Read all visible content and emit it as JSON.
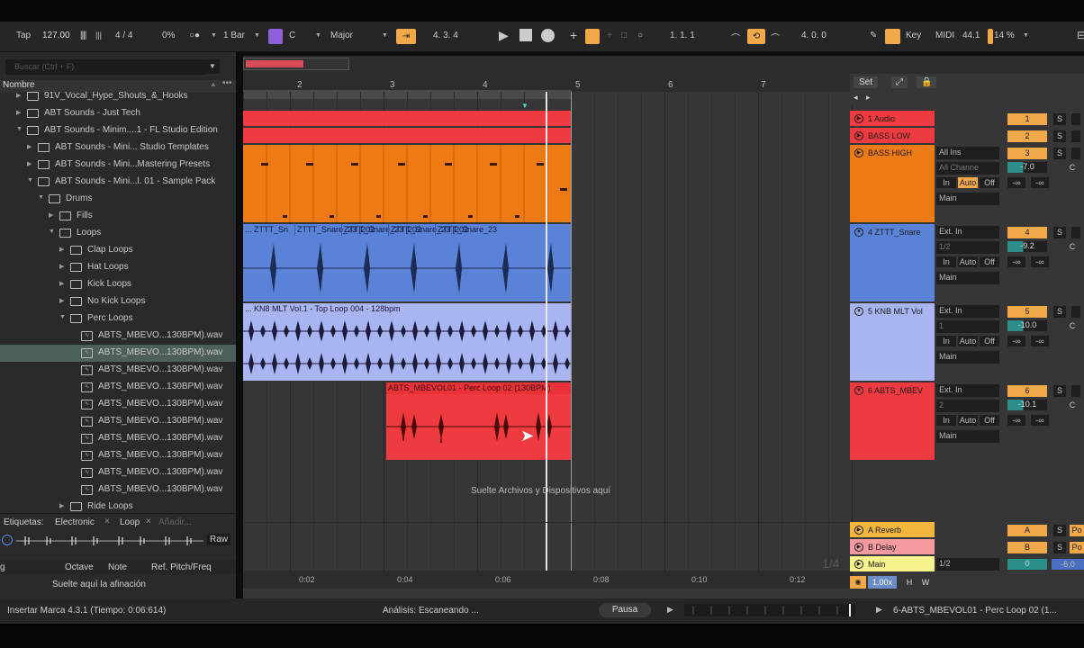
{
  "control_bar": {
    "tap": "Tap",
    "tempo": "127.00",
    "signature": "4 / 4",
    "swing": "0%",
    "quantize": "1 Bar",
    "key": "C",
    "scale": "Major",
    "position": "4.  3.  4",
    "loop_start": "1.  1.  1",
    "loop_length": "4.  0.  0",
    "key_btn": "Key",
    "midi_btn": "MIDI",
    "sample_rate": "44.1",
    "cpu": "14 %"
  },
  "browser": {
    "search_placeholder": "Buscar (Ctrl + F)",
    "column_header": "Nombre",
    "items": [
      {
        "label": "91V_Vocal_Hype_Shouts_&_Hooks",
        "type": "folder"
      },
      {
        "label": "ABT Sounds - Just Tech",
        "type": "folder"
      },
      {
        "label": "ABT Sounds - Minim....1 - FL Studio Edition",
        "type": "folder"
      },
      {
        "label": "ABT Sounds - Mini... Studio Templates",
        "type": "folder"
      },
      {
        "label": "ABT Sounds - Mini...Mastering Presets",
        "type": "folder"
      },
      {
        "label": "ABT Sounds - Mini...l. 01 - Sample Pack",
        "type": "folder"
      },
      {
        "label": "Drums",
        "type": "folder"
      },
      {
        "label": "Fills",
        "type": "folder"
      },
      {
        "label": "Loops",
        "type": "folder"
      },
      {
        "label": "Clap Loops",
        "type": "folder"
      },
      {
        "label": "Hat Loops",
        "type": "folder"
      },
      {
        "label": "Kick Loops",
        "type": "folder"
      },
      {
        "label": "No Kick Loops",
        "type": "folder"
      },
      {
        "label": "Perc Loops",
        "type": "folder"
      },
      {
        "label": "ABTS_MBEVO...130BPM).wav",
        "type": "file"
      },
      {
        "label": "ABTS_MBEVO...130BPM).wav",
        "type": "file"
      },
      {
        "label": "ABTS_MBEVO...130BPM).wav",
        "type": "file"
      },
      {
        "label": "ABTS_MBEVO...130BPM).wav",
        "type": "file"
      },
      {
        "label": "ABTS_MBEVO...130BPM).wav",
        "type": "file"
      },
      {
        "label": "ABTS_MBEVO...130BPM).wav",
        "type": "file"
      },
      {
        "label": "ABTS_MBEVO...130BPM).wav",
        "type": "file"
      },
      {
        "label": "ABTS_MBEVO...130BPM).wav",
        "type": "file"
      },
      {
        "label": "ABTS_MBEVO...130BPM).wav",
        "type": "file"
      },
      {
        "label": "ABTS_MBEVO...130BPM).wav",
        "type": "file"
      },
      {
        "label": "Ride Loops",
        "type": "folder"
      }
    ],
    "tags_label": "Etiquetas:",
    "tag1": "Electronic",
    "tag2": "Loop",
    "tag_add": "Añadir...",
    "raw": "Raw",
    "col_octave": "Octave",
    "col_note": "Note",
    "col_ref": "Ref. Pitch/Freq",
    "col_g": "g",
    "drop_tuning": "Suelte aquí la afinación"
  },
  "arrangement": {
    "bar_labels": [
      "2",
      "3",
      "4",
      "5",
      "6",
      "7"
    ],
    "time_labels": [
      "0:02",
      "0:04",
      "0:06",
      "0:08",
      "0:10",
      "0:12"
    ],
    "drop_hint": "Suelte Archivos y Dispositivos aquí",
    "quantize_display": "1/4",
    "set_btn": "Set"
  },
  "tracks": [
    {
      "name": "1 Audio",
      "number": "1",
      "color": "#ef3a3f"
    },
    {
      "name": "BASS LOW",
      "number": "2",
      "color": "#ef3a3f"
    },
    {
      "name": "BASS HIGH",
      "number": "3",
      "color": "#ee7a13",
      "input": "All Ins",
      "channel": "All Channe",
      "monitor": [
        "In",
        "Auto",
        "Off"
      ],
      "output": "Main",
      "volume": "-7.0",
      "send_a": "-∞",
      "send_b": "-∞"
    },
    {
      "name": "4 ZTTT_Snare",
      "number": "4",
      "color": "#5a83d8",
      "input": "Ext. In",
      "channel": "1/2",
      "monitor": [
        "In",
        "Auto",
        "Off"
      ],
      "output": "Main",
      "volume": "-9.2",
      "send_a": "-∞",
      "send_b": "-∞"
    },
    {
      "name": "5 KNB MLT Vol",
      "number": "5",
      "color": "#a9b4f2",
      "input": "Ext. In",
      "channel": "1",
      "monitor": [
        "In",
        "Auto",
        "Off"
      ],
      "output": "Main",
      "volume": "-10.0",
      "send_a": "-∞",
      "send_b": "-∞"
    },
    {
      "name": "6 ABTS_MBEV",
      "number": "6",
      "color": "#ef3a3f",
      "input": "Ext. In",
      "channel": "2",
      "monitor": [
        "In",
        "Auto",
        "Off"
      ],
      "output": "Main",
      "volume": "-10.1",
      "send_a": "-∞",
      "send_b": "-∞"
    }
  ],
  "returns": [
    {
      "name": "A Reverb",
      "letter": "A",
      "color": "#f2b53d"
    },
    {
      "name": "B Delay",
      "letter": "B",
      "color": "#f49aa0"
    },
    {
      "name": "Main",
      "letter": "",
      "color": "#f6f38c",
      "output": "1/2",
      "volume": "0",
      "vol2": "-6.0"
    }
  ],
  "clips": {
    "snare_titles": [
      "... ZTTT_Sn",
      "ZTTT_Snare_23 [202",
      "ZTTT_Snare_23 [202",
      "ZTTT_Snare_23 [202",
      "ZTTT_Snare_23"
    ],
    "knb_title": "... KN8 MLT Vol.1 - Top Loop 004 - 128bpm",
    "perc_title": "ABTS_MBEVOL01 - Perc Loop 02 (130BPM)"
  },
  "misc": {
    "mix_value": "1.00x",
    "h": "H",
    "w": "W",
    "solo": "S",
    "post": "Po"
  },
  "status": {
    "left": "Insertar Marca 4.3.1 (Tiempo: 0:06:614)",
    "analysis": "Análisis: Escaneando ...",
    "pause": "Pausa",
    "right": "6-ABTS_MBEVOL01 - Perc Loop 02 (1..."
  }
}
